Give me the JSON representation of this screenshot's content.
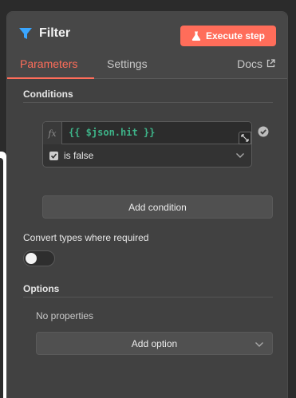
{
  "panel": {
    "title": "Filter",
    "execute_label": "Execute step",
    "tabs": [
      {
        "label": "Parameters",
        "active": true
      },
      {
        "label": "Settings",
        "active": false
      }
    ],
    "docs_label": "Docs"
  },
  "conditions": {
    "section_label": "Conditions",
    "items": [
      {
        "fx_label": "fx",
        "expression": "{{ $json.hit }}",
        "operator": "is false",
        "status_icon": "check-circle-icon"
      }
    ],
    "add_label": "Add condition"
  },
  "convert": {
    "label": "Convert types where required",
    "enabled": false
  },
  "options": {
    "section_label": "Options",
    "empty_text": "No properties",
    "add_label": "Add option"
  },
  "colors": {
    "accent": "#ff6d5a",
    "expression_green": "#3eb489",
    "filter_icon_blue": "#3aa6ff"
  }
}
